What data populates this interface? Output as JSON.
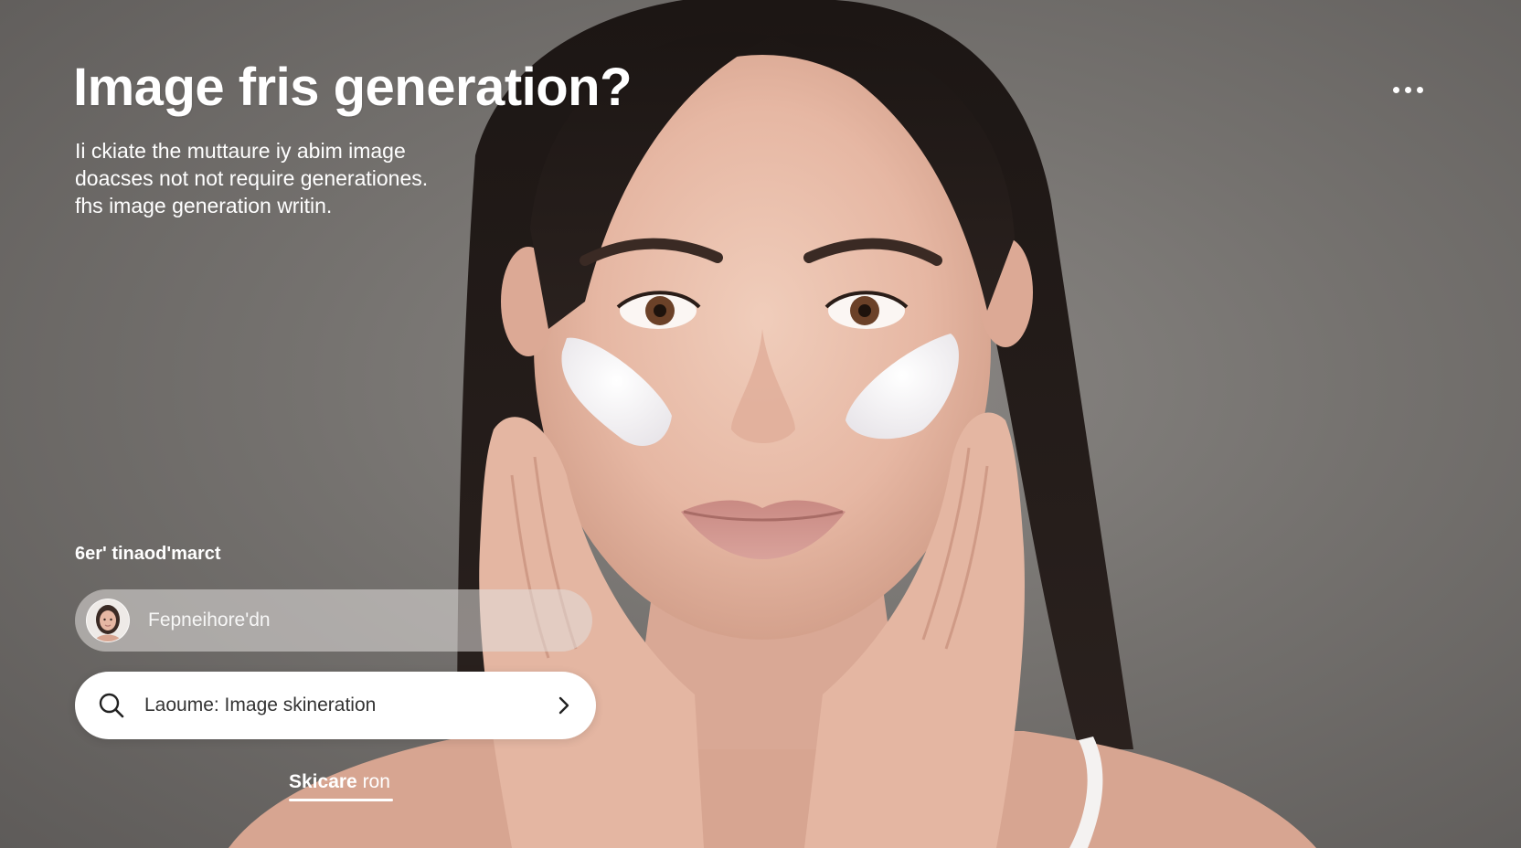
{
  "hero": {
    "headline": "Image fris generation?",
    "subtext_lines": [
      "Ii ckiate the muttaure iy abim image",
      "doacses not not require generationes.",
      "fhs image generation writin."
    ]
  },
  "menu": {
    "icon": "more-horizontal-icon"
  },
  "section": {
    "label": "6er' tinaod'marct"
  },
  "model_input": {
    "avatar_icon": "avatar-portrait",
    "value": "Fepneihore'dn"
  },
  "search": {
    "icon": "search-icon",
    "value": "Laoume: Image skineration",
    "action_icon": "chevron-right-icon"
  },
  "bottom_tab": {
    "label_bold": "Skicare",
    "label_rest": " ron"
  },
  "colors": {
    "background": "#75726f",
    "text_on_photo": "#ffffff",
    "search_bar": "#ffffff",
    "model_input_bg": "#e1dedc"
  }
}
